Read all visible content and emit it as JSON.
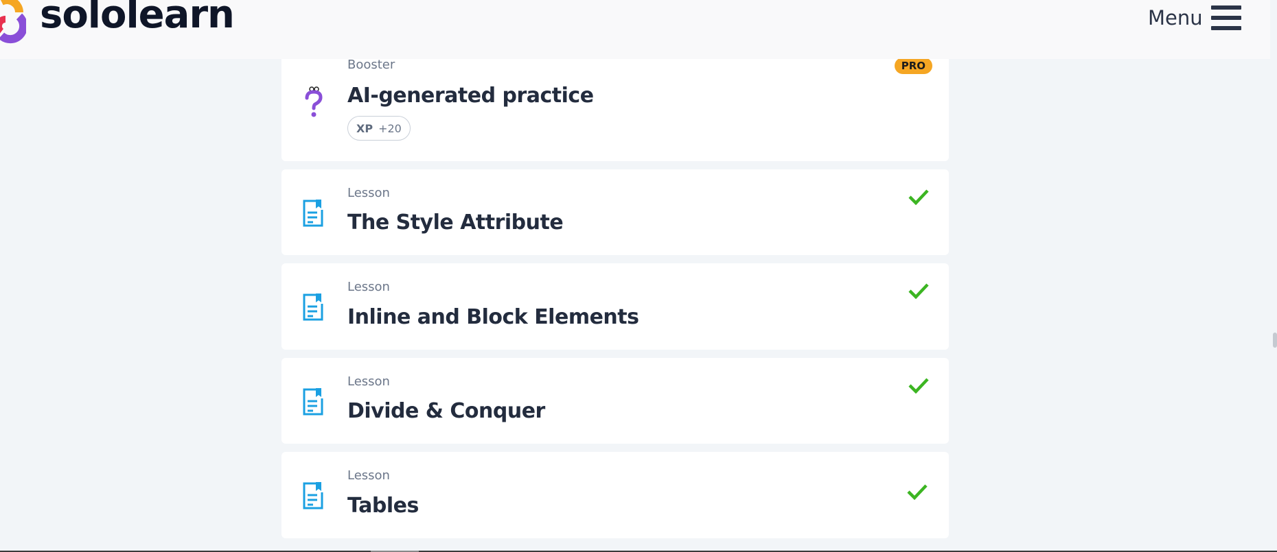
{
  "header": {
    "logo_text": "sololearn",
    "menu_label": "Menu"
  },
  "items": [
    {
      "kicker": "Booster",
      "title": "AI-generated practice",
      "badge": "PRO",
      "xp_label": "XP",
      "xp_value": "+20",
      "completed": false
    },
    {
      "kicker": "Lesson",
      "title": "The Style Attribute",
      "completed": true
    },
    {
      "kicker": "Lesson",
      "title": "Inline and Block Elements",
      "completed": true
    },
    {
      "kicker": "Lesson",
      "title": "Divide & Conquer",
      "completed": true
    },
    {
      "kicker": "Lesson",
      "title": "Tables",
      "completed": true
    }
  ],
  "colors": {
    "accent_blue": "#1ba0e2",
    "check_green": "#3cb522",
    "pro_orange": "#f5a623",
    "booster_purple": "#8a4fd8"
  },
  "icons": {
    "booster": "question-mark-icon",
    "lesson": "document-icon",
    "completed": "checkmark-icon",
    "menu": "hamburger-icon"
  }
}
